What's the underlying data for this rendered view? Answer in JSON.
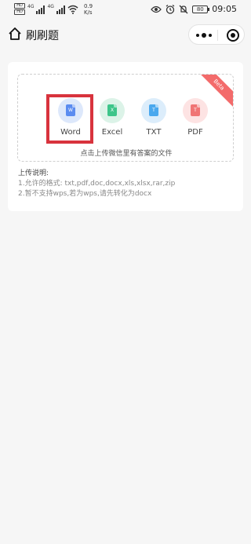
{
  "status_bar": {
    "hd_top": "HD",
    "hd_bottom": "HD",
    "net1": "4G",
    "net2": "4G",
    "speed_value": "0.9",
    "speed_unit": "K/s",
    "battery": "80",
    "time": "09:05",
    "icons": [
      "eye-icon",
      "alarm-icon",
      "mute-icon",
      "battery-icon",
      "wifi-icon",
      "signal-icon"
    ]
  },
  "nav": {
    "title": "刷刷题",
    "home_icon": "home-icon",
    "more_icon": "more-dots-icon",
    "close_icon": "target-close-icon"
  },
  "upload": {
    "badge": "Beta",
    "file_types": [
      {
        "label": "Word",
        "glyph": "W",
        "bg": "#dde8fb",
        "fg": "#5b8cf0"
      },
      {
        "label": "Excel",
        "glyph": "X",
        "bg": "#dcf3e8",
        "fg": "#3ec58a"
      },
      {
        "label": "TXT",
        "glyph": "T",
        "bg": "#dcedfb",
        "fg": "#4aa8ee"
      },
      {
        "label": "PDF",
        "glyph": "T",
        "bg": "#fde3e3",
        "fg": "#f07474"
      }
    ],
    "hint": "点击上传微信里有答案的文件",
    "highlighted": "Word"
  },
  "notes": {
    "title": "上传说明:",
    "line1": "1.允许的格式: txt,pdf,doc,docx,xls,xlsx,rar,zip",
    "line2": "2.暂不支持wps,若为wps,请先转化为docx"
  },
  "colors": {
    "accent_red": "#d8333d",
    "badge_red": "#f36b6b",
    "background": "#f6f6f6"
  }
}
